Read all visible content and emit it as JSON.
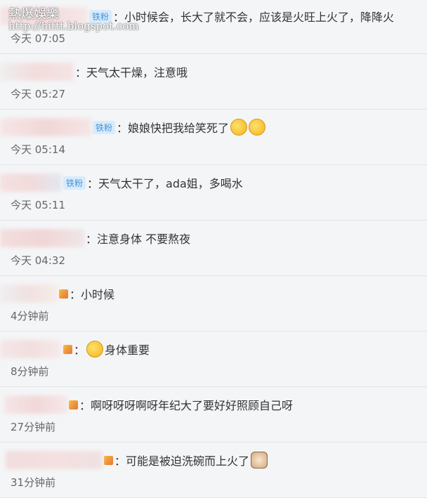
{
  "watermark": {
    "title": "熱爆娛樂",
    "url": "http://hittt.blogspot.com"
  },
  "comments": [
    {
      "badge": "铁粉",
      "badge_prefix": ":",
      "text": "小时候会，长大了就不会，应该是火旺上火了，降降火",
      "time": "今天 07:05"
    },
    {
      "text": "天气太干燥，注意哦",
      "time": "今天 05:27"
    },
    {
      "badge": "铁粉",
      "text": "娘娘快把我给笑死了",
      "time": "今天 05:14"
    },
    {
      "badge": "铁粉",
      "text": "天气太干了，ada姐，多喝水",
      "time": "今天 05:11"
    },
    {
      "text": "注意身体 不要熬夜",
      "time": "今天 04:32"
    },
    {
      "text": "小时候",
      "time": "4分钟前"
    },
    {
      "text": "身体重要",
      "time": "8分钟前"
    },
    {
      "text": "啊呀呀呀啊呀年纪大了要好好照顾自己呀",
      "time": "27分钟前"
    },
    {
      "text": "可能是被迫洗碗而上火了",
      "time": "31分钟前"
    }
  ],
  "colors": {
    "badge_bg": "#d7ecfb",
    "badge_text": "#4a90d9",
    "background": "#f4f5f7"
  }
}
